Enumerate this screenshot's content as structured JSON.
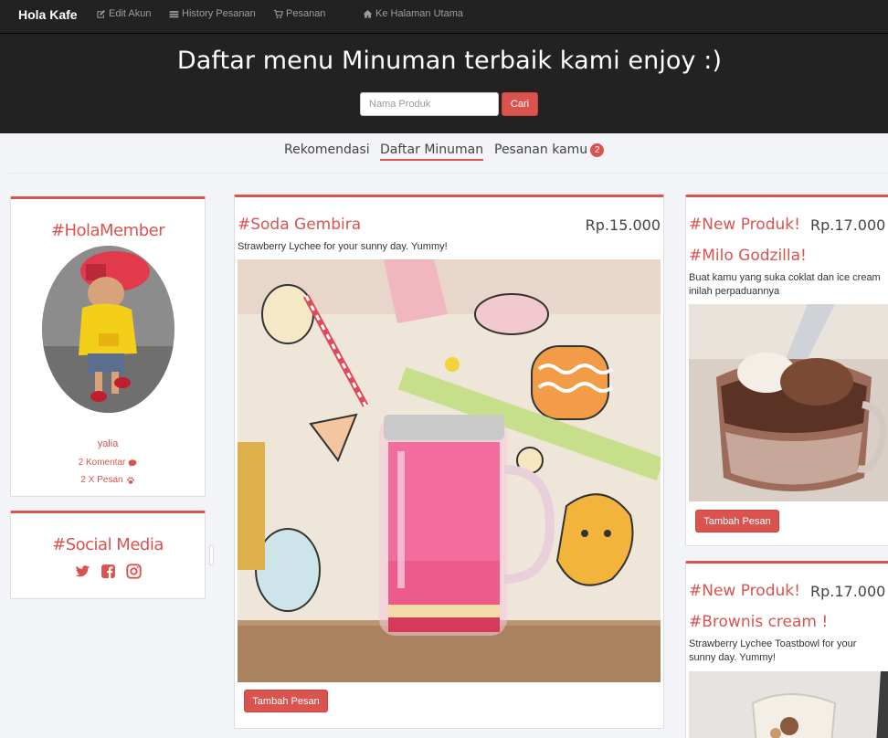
{
  "navbar": {
    "brand": "Hola Kafe",
    "links": [
      {
        "label": "Edit Akun",
        "icon": "edit-icon"
      },
      {
        "label": "History Pesanan",
        "icon": "list-icon"
      },
      {
        "label": "Pesanan",
        "icon": "cart-icon"
      },
      {
        "label": "Ke Halaman Utama",
        "icon": "home-icon"
      }
    ]
  },
  "hero": {
    "title": "Daftar menu Minuman terbaik kami enjoy :)",
    "search_placeholder": "Nama Produk",
    "search_button": "Cari"
  },
  "tabs": {
    "items": [
      "Rekomendasi",
      "Daftar Minuman",
      "Pesanan kamu"
    ],
    "active": "Daftar Minuman",
    "badge": "2"
  },
  "member": {
    "title": "#HolaMember",
    "name": "yalia",
    "comments": "2 Komentar",
    "orders": "2 X Pesan"
  },
  "social": {
    "title": "#Social Media",
    "icons": [
      "twitter-icon",
      "facebook-icon",
      "instagram-icon"
    ]
  },
  "main_product": {
    "name": "#Soda Gembira",
    "price": "Rp.15.000",
    "description": "Strawberry Lychee for your sunny day. Yummy!",
    "button": "Tambah Pesan"
  },
  "side_products": [
    {
      "tag": "#New Produk!",
      "price": "Rp.17.000",
      "name": "#Milo Godzilla!",
      "description": "Buat kamu yang suka coklat dan ice cream inilah perpaduannya",
      "button": "Tambah Pesan"
    },
    {
      "tag": "#New Produk!",
      "price": "Rp.17.000",
      "name": "#Brownis cream !",
      "description": "Strawberry Lychee Toastbowl for your sunny day. Yummy!"
    }
  ],
  "colors": {
    "accent": "#d9534f",
    "navbar_bg": "#222222",
    "page_bg": "#f2f4f8"
  }
}
